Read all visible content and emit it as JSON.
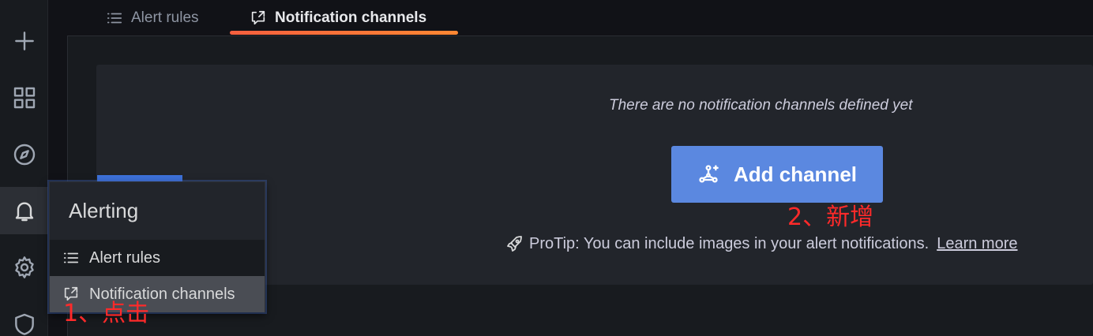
{
  "tabs": [
    {
      "label": "Alert rules",
      "icon": "list-icon"
    },
    {
      "label": "Notification channels",
      "icon": "comment-alt-share-icon"
    }
  ],
  "sidebar": {
    "icons": [
      "plus-icon",
      "apps-icon",
      "compass-icon",
      "bell-icon",
      "cog-icon",
      "shield-icon"
    ],
    "active": "bell-icon"
  },
  "submenu": {
    "title": "Alerting",
    "items": [
      {
        "label": "Alert rules",
        "icon": "list-icon"
      },
      {
        "label": "Notification channels",
        "icon": "comment-alt-share-icon",
        "highlighted": true
      }
    ]
  },
  "empty_state": {
    "title": "There are no notification channels defined yet",
    "button_label": "Add channel",
    "button_icon": "channel-add-icon",
    "protip_text": "ProTip: You can include images in your alert notifications.",
    "protip_link": "Learn more",
    "protip_icon": "rocket-icon"
  },
  "annotations": {
    "step1": "1、点击",
    "step2": "2、新增"
  },
  "colors": {
    "accent_button": "#5b88e0",
    "tab_underline": "#ff6a3d",
    "annotation": "#ff2a2a"
  }
}
